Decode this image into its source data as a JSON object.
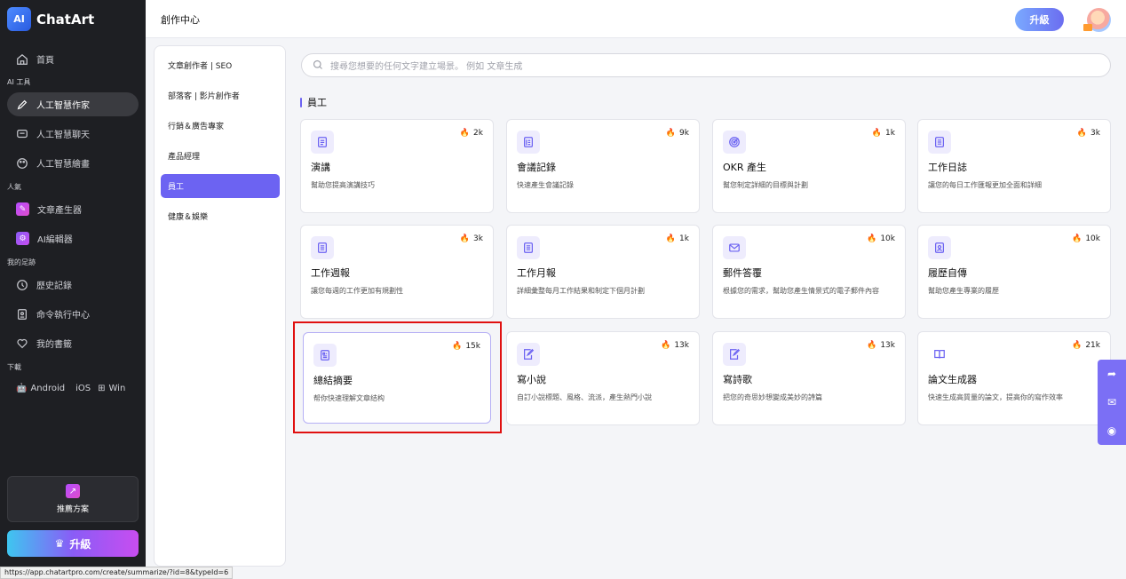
{
  "app": {
    "name": "ChatArt"
  },
  "sidebar": {
    "home": "首頁",
    "ai_tools_label": "AI 工具",
    "ai_items": [
      "人工智慧作家",
      "人工智慧聊天",
      "人工智慧繪畫"
    ],
    "popular_label": "人氣",
    "popular_items": [
      "文章產生器",
      "AI編輯器"
    ],
    "my_label": "我的足跡",
    "my_items": [
      "歷史記錄",
      "命令執行中心",
      "我的書籤"
    ],
    "download_label": "下載",
    "download_platforms": [
      "Android",
      "iOS",
      "Win"
    ],
    "recommend_label": "推薦方案",
    "upgrade_label": "升級"
  },
  "header": {
    "title": "創作中心",
    "upgrade_label": "升級"
  },
  "categories": [
    "文章創作者 | SEO",
    "部落客 | 影片創作者",
    "行銷＆廣告專家",
    "產品經理",
    "員工",
    "健康＆娛樂"
  ],
  "active_category": "員工",
  "search": {
    "placeholder": "搜尋您想要的任何文字建立場景。 例如 文章生成"
  },
  "section_title": "員工",
  "cards": [
    {
      "title": "演講",
      "desc": "幫助您提高演講技巧",
      "count": "2k",
      "icon": "document-icon"
    },
    {
      "title": "會議記錄",
      "desc": "快速產生會議記錄",
      "count": "9k",
      "icon": "notes-icon"
    },
    {
      "title": "OKR 產生",
      "desc": "幫您制定詳細的目標與計劃",
      "count": "1k",
      "icon": "target-icon"
    },
    {
      "title": "工作日誌",
      "desc": "讓您的每日工作匯報更加全面和詳細",
      "count": "3k",
      "icon": "journal-icon"
    },
    {
      "title": "工作週報",
      "desc": "讓您每週的工作更加有規劃性",
      "count": "3k",
      "icon": "document-icon"
    },
    {
      "title": "工作月報",
      "desc": "詳細彙整每月工作結果和制定下個月計劃",
      "count": "1k",
      "icon": "document-icon"
    },
    {
      "title": "郵件答覆",
      "desc": "根據您的需求，幫助您產生情景式的電子郵件內容",
      "count": "10k",
      "icon": "mail-icon"
    },
    {
      "title": "履歷自傳",
      "desc": "幫助您產生專業的履歷",
      "count": "10k",
      "icon": "resume-icon"
    },
    {
      "title": "總結摘要",
      "desc": "帮你快速理解文章结构",
      "count": "15k",
      "icon": "summary-icon"
    },
    {
      "title": "寫小說",
      "desc": "自訂小說標題、風格、流派，產生熱門小說",
      "count": "13k",
      "icon": "edit-icon"
    },
    {
      "title": "寫詩歌",
      "desc": "把您的奇思妙想變成美妙的詩篇",
      "count": "13k",
      "icon": "edit-icon"
    },
    {
      "title": "論文生成器",
      "desc": "快速生成高質量的論文，提高你的寫作效率",
      "count": "21k",
      "icon": "book-icon"
    }
  ],
  "statusbar": {
    "url": "https://app.chatartpro.com/create/summarize/?id=8&typeId=6"
  },
  "colors": {
    "accent": "#6c63f2",
    "sidebar_bg": "#1e1f23",
    "fire": "#ff6a1a",
    "highlight": "#e01010"
  }
}
